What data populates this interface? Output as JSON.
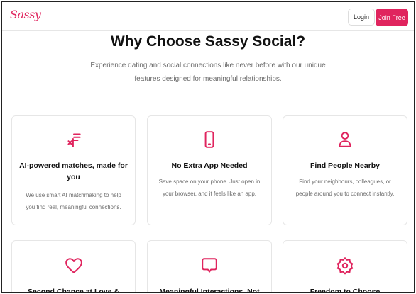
{
  "header": {
    "logo_text": "Sassy",
    "login_label": "Login",
    "join_label": "Join Free"
  },
  "hero": {
    "title": "Why Choose Sassy Social?",
    "subtitle": "Experience dating and social connections like never before with our unique features designed for meaningful relationships."
  },
  "features": [
    {
      "icon": "sparkle-lines-icon",
      "title": "AI-powered matches, made for you",
      "description": "We use smart AI matchmaking to help you find real, meaningful connections."
    },
    {
      "icon": "smartphone-icon",
      "title": "No Extra App Needed",
      "description": "Save space on your phone. Just open in your browser, and it feels like an app."
    },
    {
      "icon": "user-icon",
      "title": "Find People Nearby",
      "description": "Find your neighbours, colleagues, or people around you to connect instantly."
    },
    {
      "icon": "heart-icon",
      "title": "Second Chance at Love &",
      "description": ""
    },
    {
      "icon": "message-square-icon",
      "title": "Meaningful Interactions, Not",
      "description": ""
    },
    {
      "icon": "badge-icon",
      "title": "Freedom to Choose",
      "description": ""
    }
  ],
  "colors": {
    "accent": "#e0245e",
    "muted_text": "#6b6b6b",
    "border": "#e6e6e6"
  }
}
